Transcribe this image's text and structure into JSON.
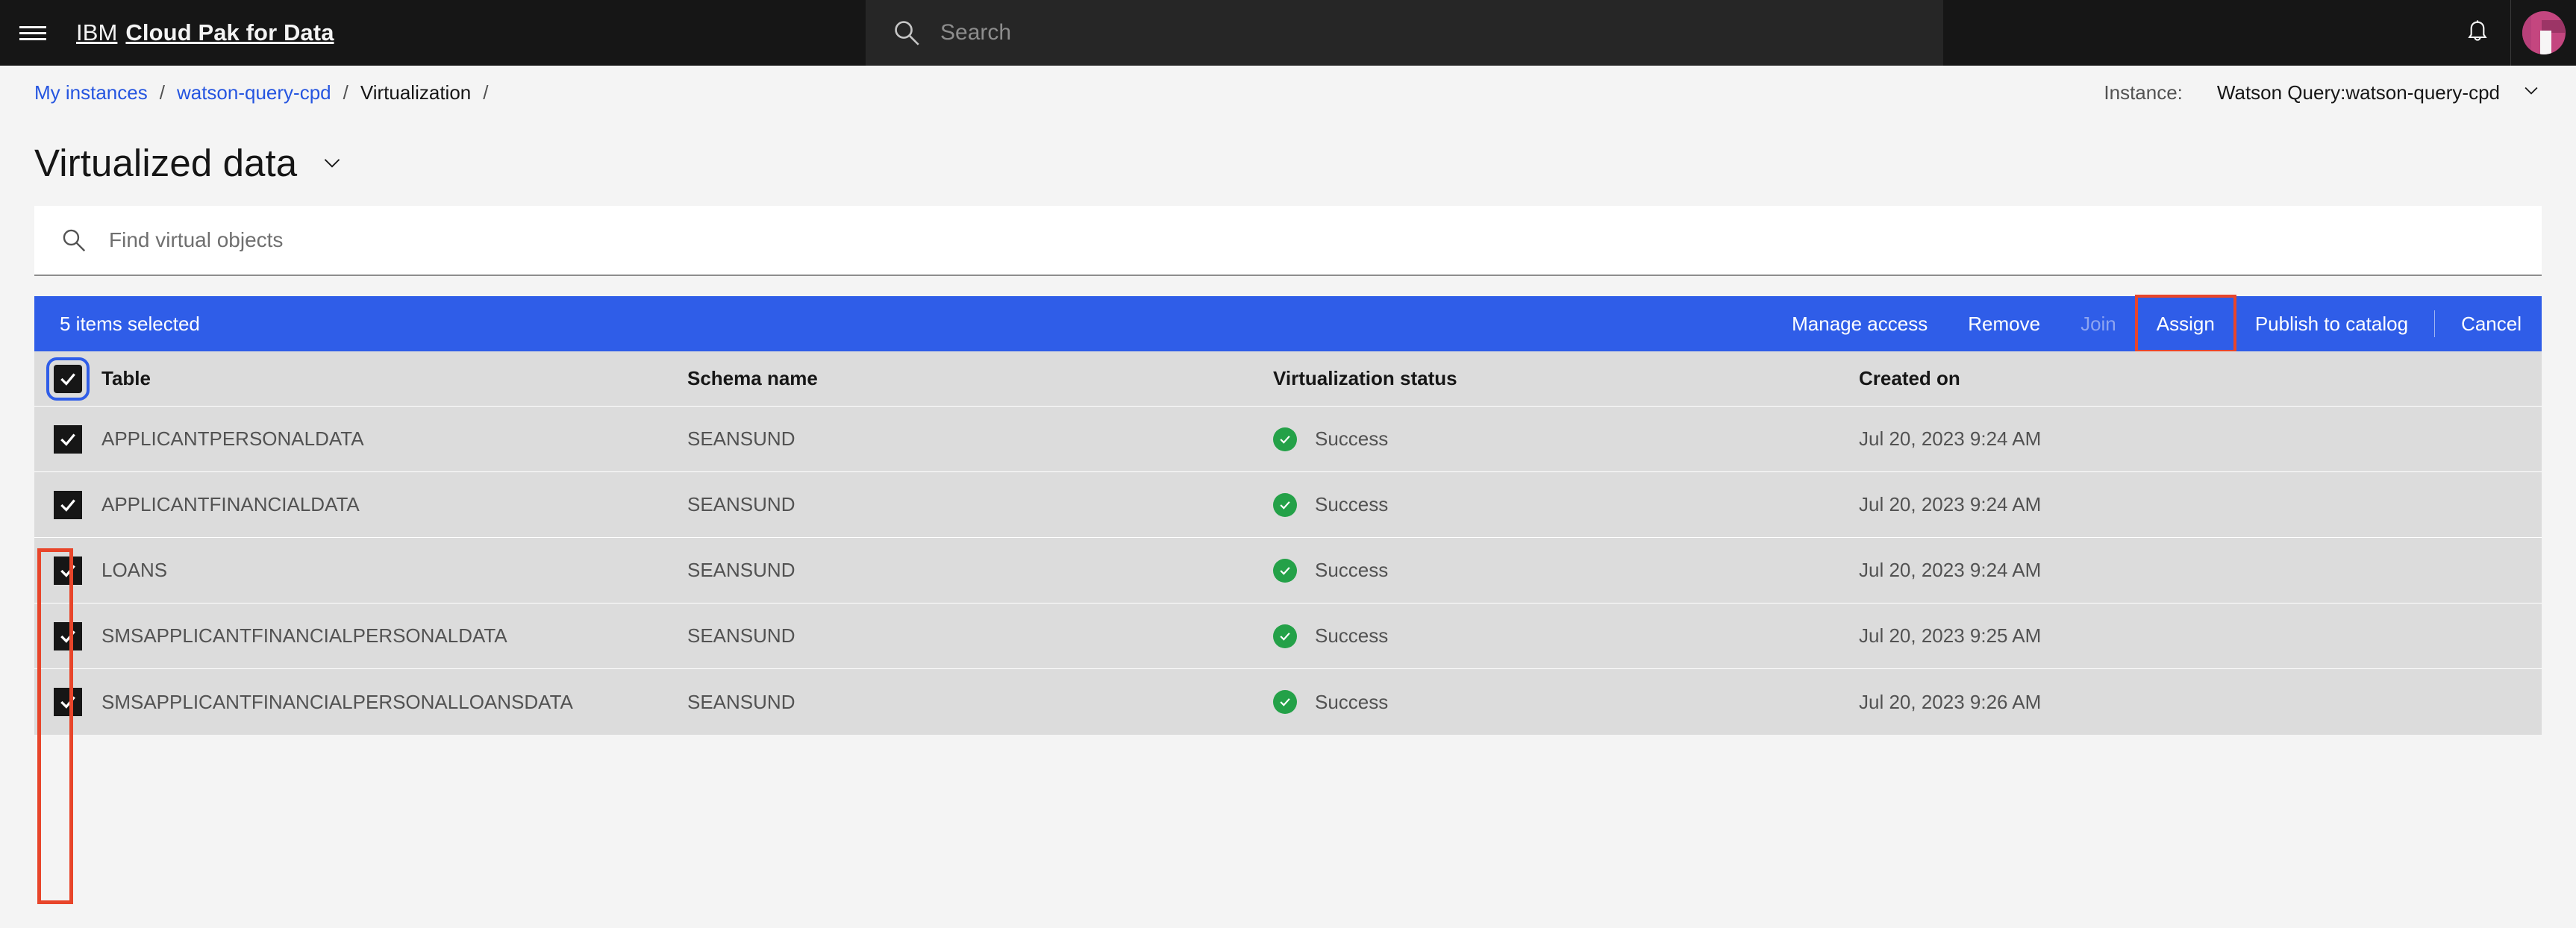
{
  "header": {
    "menu_icon": "hamburger-menu-icon",
    "brand_prefix": "IBM",
    "brand_name": "Cloud Pak for Data",
    "search_placeholder": "Search",
    "search_icon": "search-icon",
    "notifications_icon": "bell-icon",
    "avatar": "user-avatar"
  },
  "breadcrumb": {
    "items": [
      {
        "label": "My instances",
        "is_link": true
      },
      {
        "label": "watson-query-cpd",
        "is_link": true
      },
      {
        "label": "Virtualization",
        "is_link": false
      }
    ],
    "separator": "/",
    "trailing_separator": "/",
    "instance_label": "Instance:",
    "instance_value": "Watson Query:watson-query-cpd",
    "instance_chevron": "chevron-down-icon"
  },
  "page": {
    "title": "Virtualized data",
    "title_chevron": "chevron-down-icon"
  },
  "search": {
    "placeholder": "Find virtual objects",
    "value": "",
    "icon": "search-icon"
  },
  "action_bar": {
    "selected_text": "5 items selected",
    "background": "#2f5de8",
    "actions": [
      {
        "label": "Manage access",
        "state": "enabled",
        "highlighted": false
      },
      {
        "label": "Remove",
        "state": "enabled",
        "highlighted": false
      },
      {
        "label": "Join",
        "state": "disabled",
        "highlighted": false
      },
      {
        "label": "Assign",
        "state": "enabled",
        "highlighted": true
      },
      {
        "label": "Publish to catalog",
        "state": "enabled",
        "highlighted": false
      },
      {
        "label": "Cancel",
        "state": "enabled",
        "highlighted": false
      }
    ]
  },
  "table": {
    "select_all_checked": true,
    "columns": [
      "Table",
      "Schema name",
      "Virtualization status",
      "Created on"
    ],
    "rows": [
      {
        "checked": true,
        "table": "APPLICANTPERSONALDATA",
        "schema": "SEANSUND",
        "status": "Success",
        "created": "Jul 20, 2023 9:24 AM"
      },
      {
        "checked": true,
        "table": "APPLICANTFINANCIALDATA",
        "schema": "SEANSUND",
        "status": "Success",
        "created": "Jul 20, 2023 9:24 AM"
      },
      {
        "checked": true,
        "table": "LOANS",
        "schema": "SEANSUND",
        "status": "Success",
        "created": "Jul 20, 2023 9:24 AM"
      },
      {
        "checked": true,
        "table": "SMSAPPLICANTFINANCIALPERSONALDATA",
        "schema": "SEANSUND",
        "status": "Success",
        "created": "Jul 20, 2023 9:25 AM"
      },
      {
        "checked": true,
        "table": "SMSAPPLICANTFINANCIALPERSONALLOANSDATA",
        "schema": "SEANSUND",
        "status": "Success",
        "created": "Jul 20, 2023 9:26 AM"
      }
    ]
  },
  "annotations": {
    "color": "#e8452a",
    "highlight_action": "Assign",
    "highlight_checkbox_column": true
  }
}
